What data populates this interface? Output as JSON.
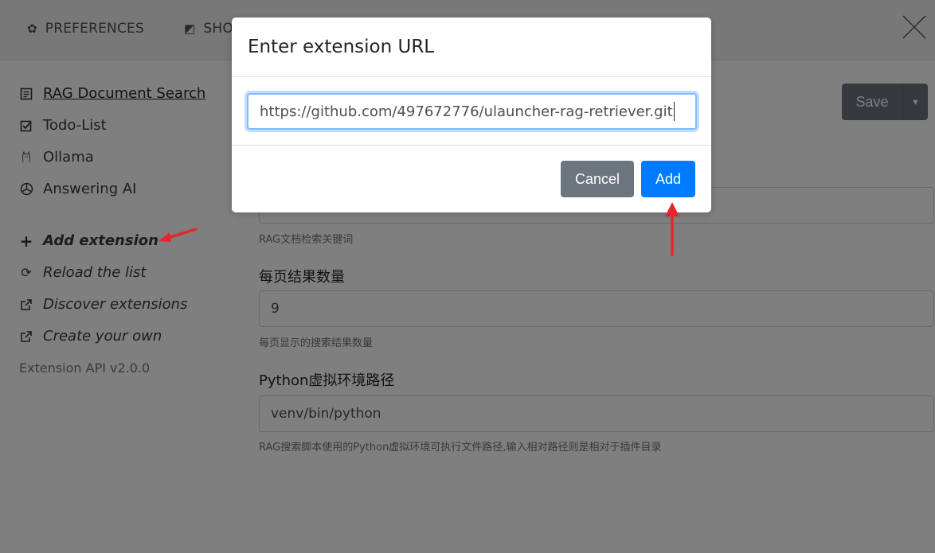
{
  "topbar": {
    "tabs": [
      {
        "label": "PREFERENCES",
        "icon": "gear-icon"
      },
      {
        "label": "SHO",
        "icon": "external-link-icon"
      }
    ],
    "close_icon": "close-icon"
  },
  "sidebar": {
    "extensions": [
      {
        "label": "RAG Document Search",
        "icon": "document-icon",
        "active": true
      },
      {
        "label": "Todo-List",
        "icon": "checkbox-icon",
        "active": false
      },
      {
        "label": "Ollama",
        "icon": "llama-icon",
        "active": false
      },
      {
        "label": "Answering AI",
        "icon": "openai-icon",
        "active": false
      }
    ],
    "actions": [
      {
        "label": "Add extension",
        "icon": "plus-icon"
      },
      {
        "label": "Reload the list",
        "icon": "refresh-icon"
      },
      {
        "label": "Discover extensions",
        "icon": "external-link-icon"
      },
      {
        "label": "Create your own",
        "icon": "external-link-icon"
      }
    ],
    "api_version": "Extension API v2.0.0"
  },
  "main": {
    "save_label": "Save",
    "fields": [
      {
        "label": "",
        "value": "",
        "help": "RAG文档检索关键词"
      },
      {
        "label": "每页结果数量",
        "value": "9",
        "help": "每页显示的搜索结果数量"
      },
      {
        "label": "Python虚拟环境路径",
        "value": "venv/bin/python",
        "help": "RAG搜索脚本使用的Python虚拟环境可执行文件路径,输入相对路径则是相对于插件目录"
      }
    ]
  },
  "modal": {
    "title": "Enter extension URL",
    "url_value": "https://github.com/497672776/ulauncher-rag-retriever.git",
    "cancel_label": "Cancel",
    "add_label": "Add"
  },
  "colors": {
    "primary": "#007bff",
    "secondary": "#6c757d",
    "annotation_arrow": "#e8252a"
  }
}
